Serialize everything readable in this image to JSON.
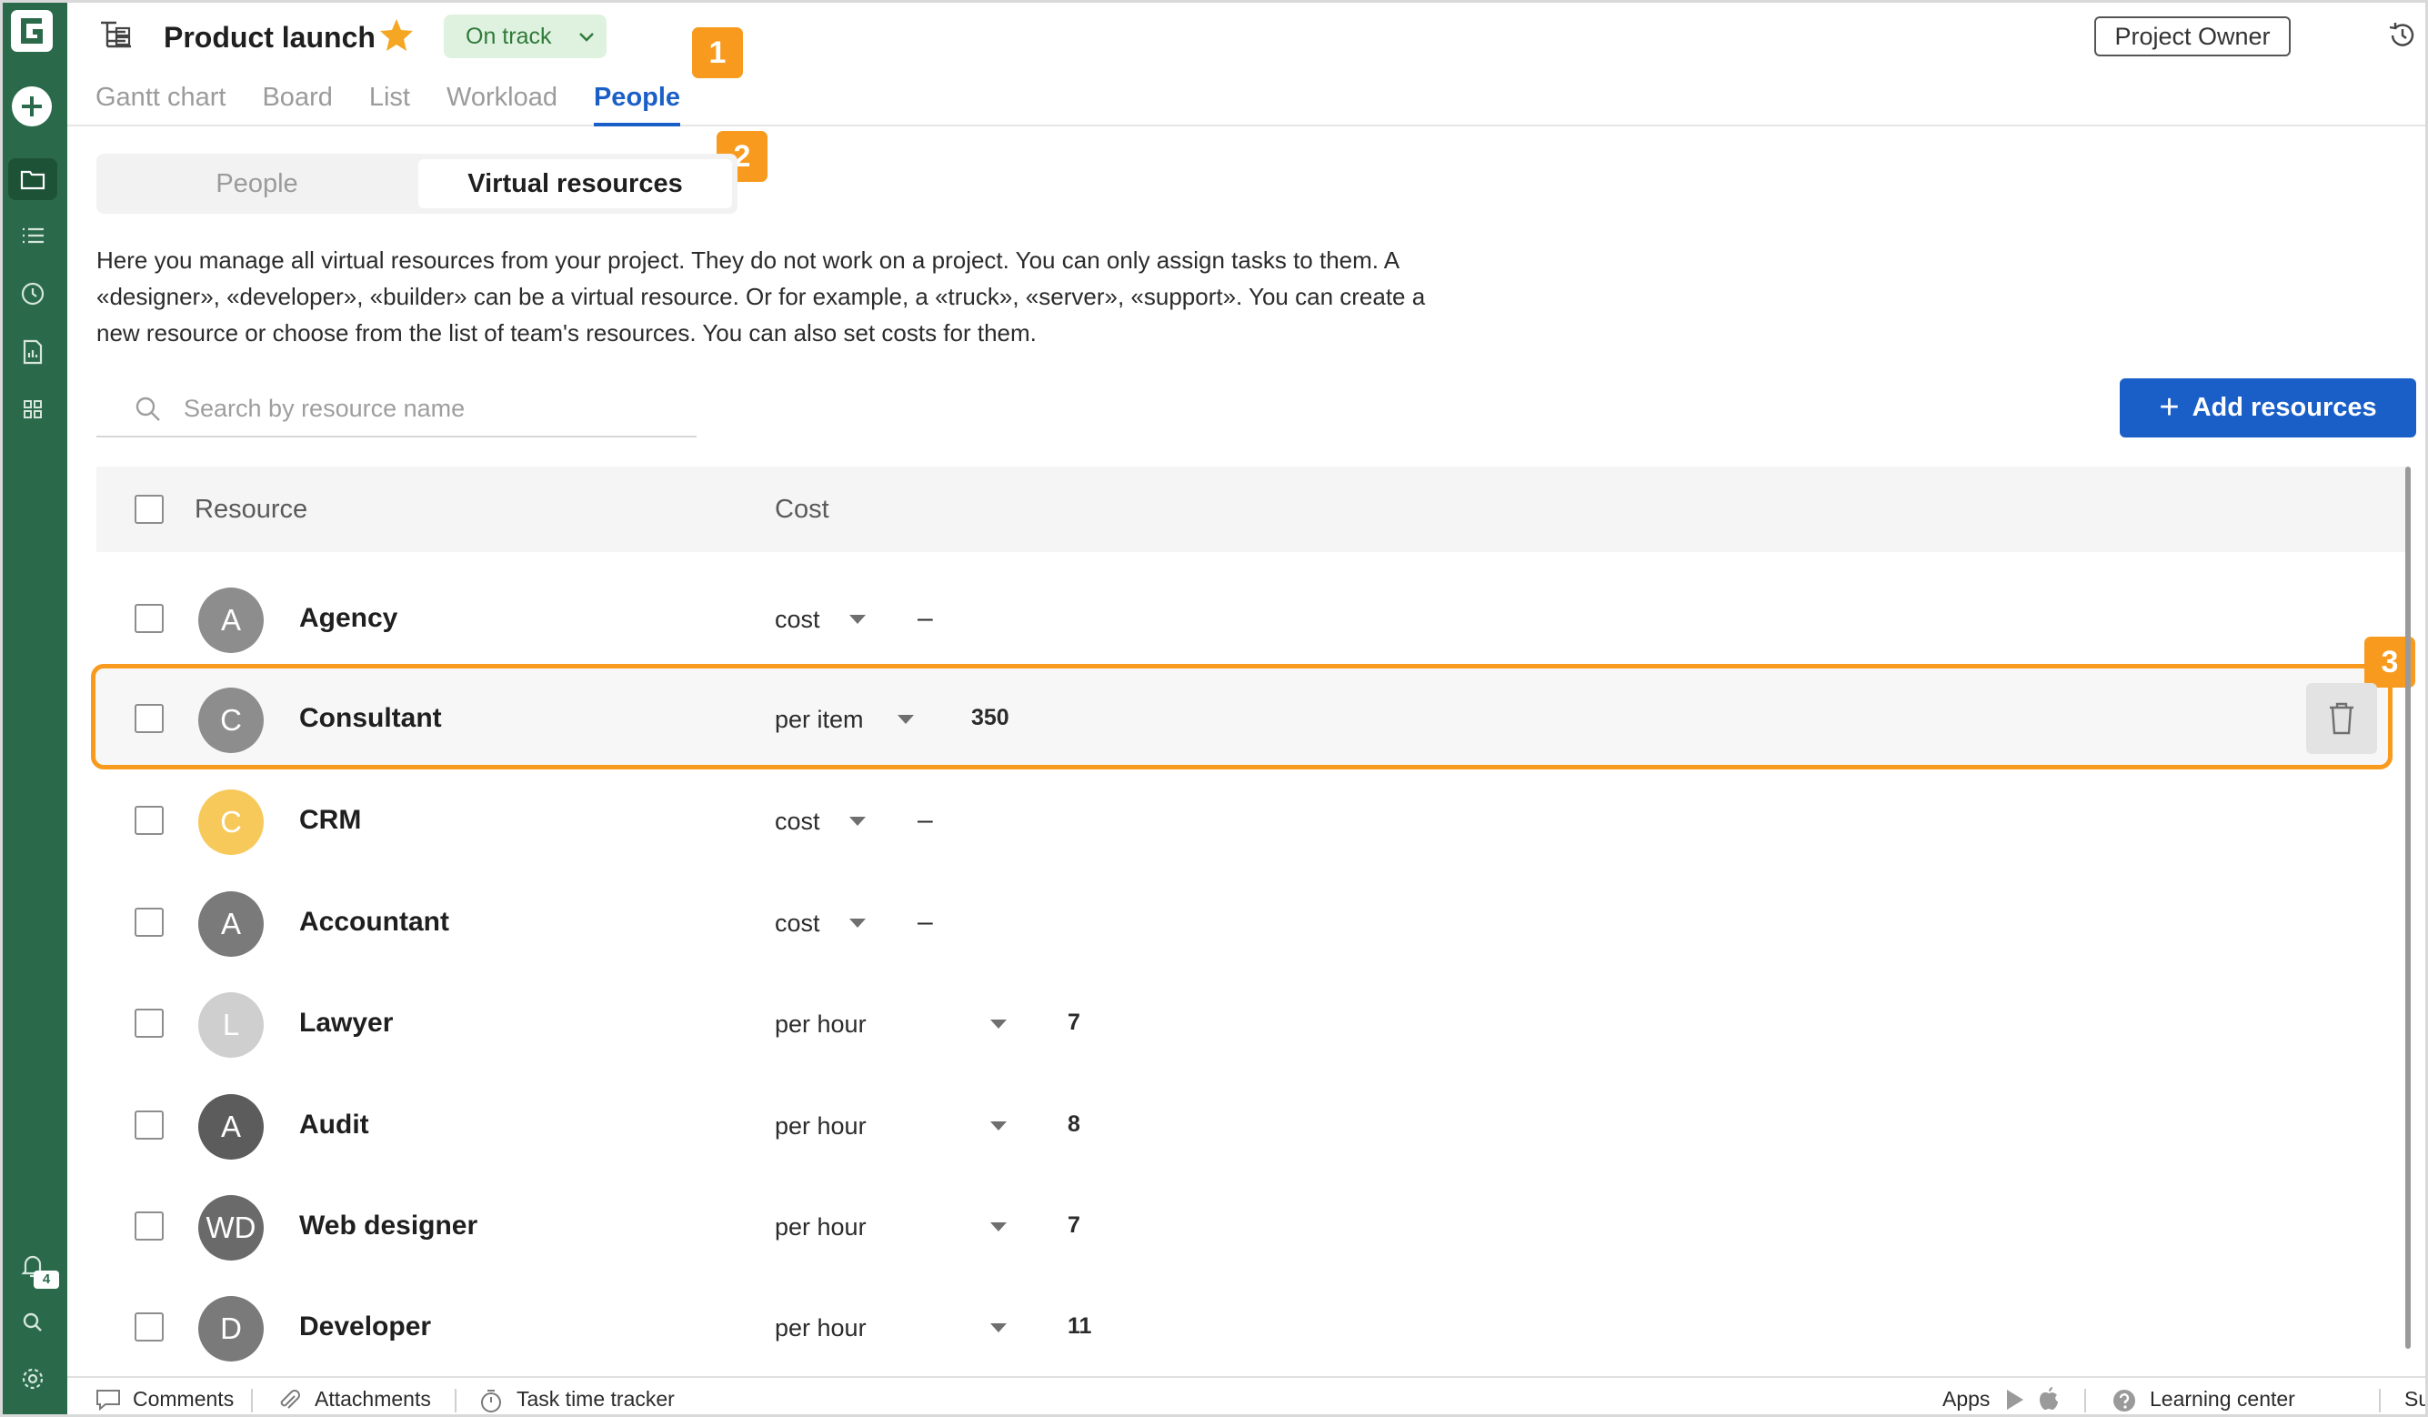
{
  "colors": {
    "rail": "#2a6a4a",
    "accent": "#1a5fc8",
    "highlight": "#f79a1d",
    "status_bg": "#dff1df",
    "status_text": "#2f7a3a"
  },
  "rail": {
    "notification_count": "4"
  },
  "header": {
    "title": "Product launch",
    "status": "On track",
    "owner_label": "Project Owner",
    "tabs": [
      {
        "label": "Gantt chart"
      },
      {
        "label": "Board"
      },
      {
        "label": "List"
      },
      {
        "label": "Workload"
      },
      {
        "label": "People"
      }
    ]
  },
  "markers": [
    "1",
    "2",
    "3"
  ],
  "segments": {
    "people": "People",
    "virtual": "Virtual resources"
  },
  "description": "Here you manage all virtual resources from your project. They do not work on a project. You can only assign tasks to them. A «designer», «developer», «builder» can be a virtual resource. Or for example, a «truck», «server», «support». You can create a new resource or choose from the list of team's resources. You can also set costs for them.",
  "search": {
    "placeholder": "Search by resource name"
  },
  "add_button": "Add resources",
  "table": {
    "headers": {
      "resource": "Resource",
      "cost": "Cost"
    },
    "rows": [
      {
        "initials": "A",
        "name": "Agency",
        "cost_type": "cost",
        "value": "–",
        "avatar_color": "#8d8d8d"
      },
      {
        "initials": "C",
        "name": "Consultant",
        "cost_type": "per item",
        "value": "350",
        "avatar_color": "#8d8d8d"
      },
      {
        "initials": "C",
        "name": "CRM",
        "cost_type": "cost",
        "value": "–",
        "avatar_color": "#f7c95a"
      },
      {
        "initials": "A",
        "name": "Accountant",
        "cost_type": "cost",
        "value": "–",
        "avatar_color": "#7a7a7a"
      },
      {
        "initials": "L",
        "name": "Lawyer",
        "cost_type": "per hour",
        "value": "7",
        "avatar_color": "#cfcfcf"
      },
      {
        "initials": "A",
        "name": "Audit",
        "cost_type": "per hour",
        "value": "8",
        "avatar_color": "#5c5c5c"
      },
      {
        "initials": "WD",
        "name": "Web designer",
        "cost_type": "per hour",
        "value": "7",
        "avatar_color": "#6a6a6a"
      },
      {
        "initials": "D",
        "name": "Developer",
        "cost_type": "per hour",
        "value": "11",
        "avatar_color": "#7a7a7a"
      }
    ]
  },
  "footer": {
    "comments": "Comments",
    "attachments": "Attachments",
    "time_tracker": "Task time tracker",
    "apps": "Apps",
    "learning": "Learning center",
    "support": "Support"
  }
}
